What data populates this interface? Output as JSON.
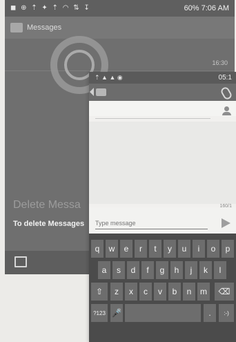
{
  "back_screen": {
    "status_time": "60%  7:06 AM",
    "title": "Messages",
    "time": "16:30",
    "delete_title": "Delete Messa",
    "delete_subtitle": "To delete Messages"
  },
  "front_screen": {
    "status_time": "05:1",
    "char_counter": "160/1",
    "message_placeholder": "Type message"
  },
  "keyboard": {
    "row1": [
      "q",
      "w",
      "e",
      "r",
      "t",
      "y",
      "u",
      "i",
      "o",
      "p"
    ],
    "row2": [
      "a",
      "s",
      "d",
      "f",
      "g",
      "h",
      "j",
      "k",
      "l"
    ],
    "row3": [
      "⇧",
      "z",
      "x",
      "c",
      "v",
      "b",
      "n",
      "m",
      "⌫"
    ],
    "row4": [
      "?123",
      "🎤",
      "",
      ".",
      ":-)"
    ]
  },
  "colors": {
    "background": "#ecebe8",
    "keyboard": "#4b4b4b",
    "key": "#6d6d6d"
  }
}
